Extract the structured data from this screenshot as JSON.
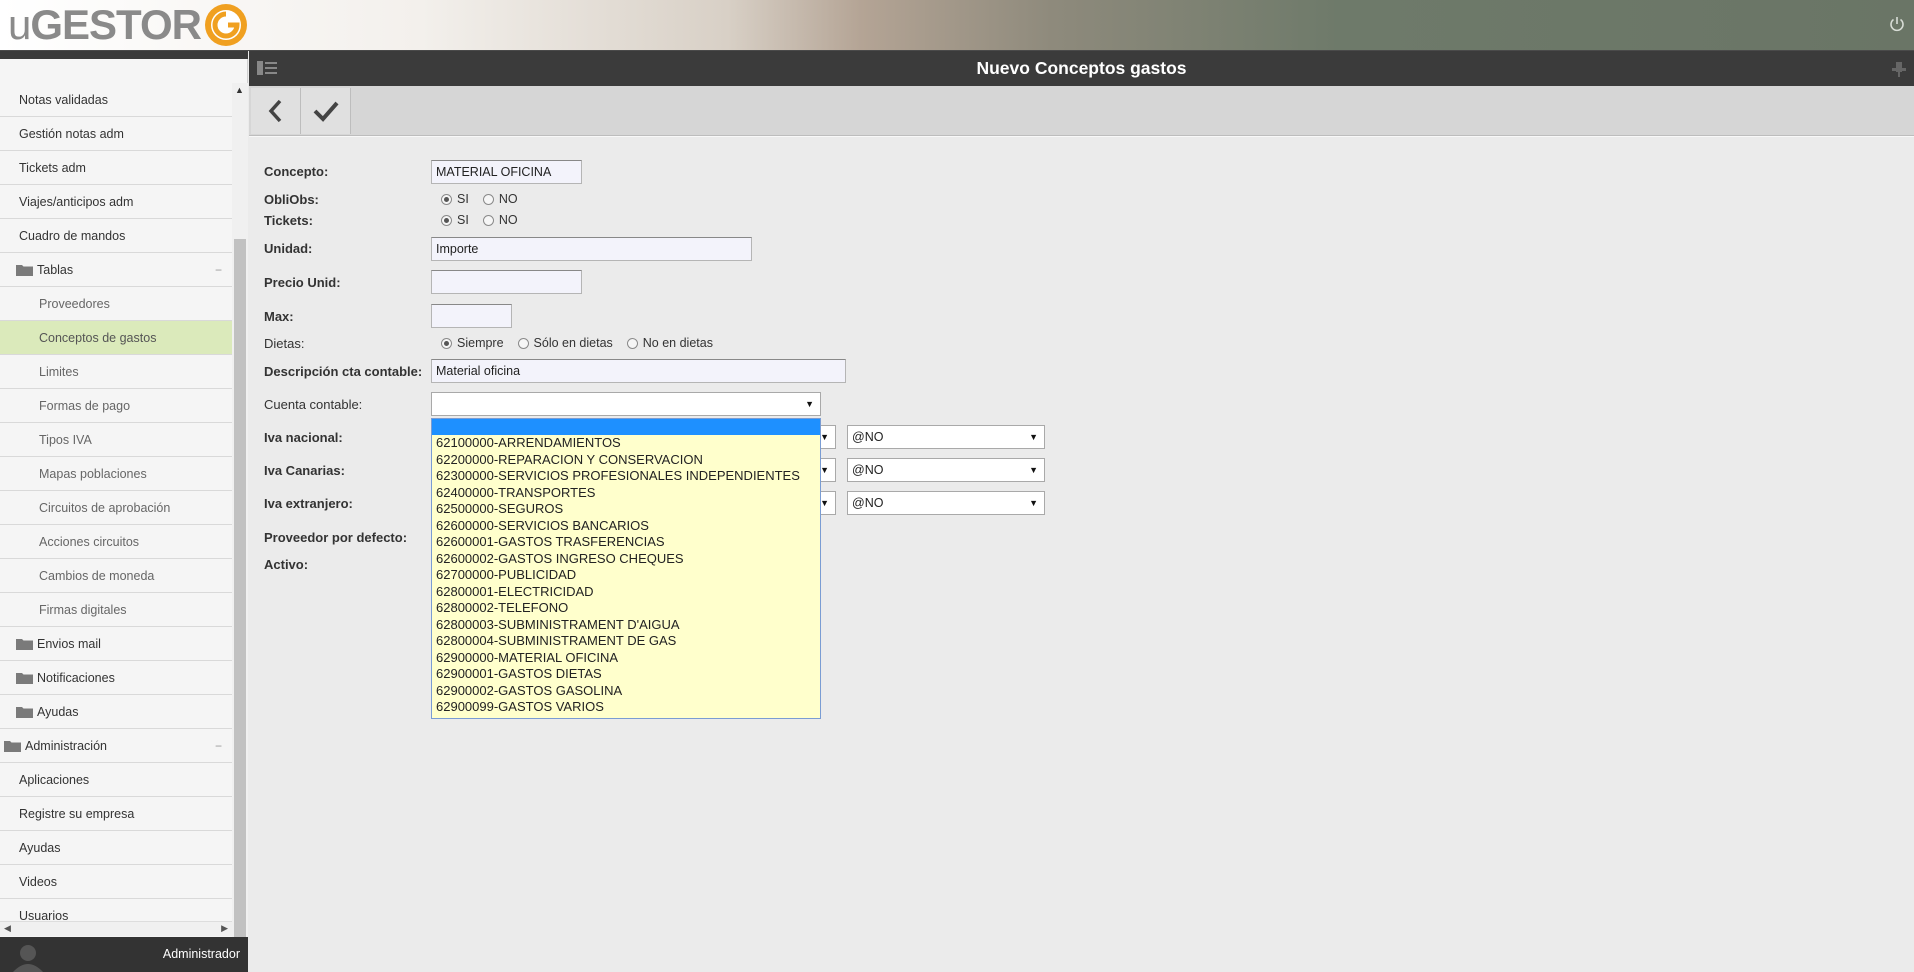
{
  "header": {
    "logo_prefix": "u",
    "logo_name": "GESTOR"
  },
  "main": {
    "title": "Nuevo Conceptos gastos"
  },
  "sidebar": {
    "items": [
      {
        "label": "Notas validadas"
      },
      {
        "label": "Gestión notas adm"
      },
      {
        "label": "Tickets adm"
      },
      {
        "label": "Viajes/anticipos adm"
      },
      {
        "label": "Cuadro de mandos"
      },
      {
        "label": "Tablas"
      },
      {
        "label": "Proveedores"
      },
      {
        "label": "Conceptos de gastos"
      },
      {
        "label": "Limites"
      },
      {
        "label": "Formas de pago"
      },
      {
        "label": "Tipos IVA"
      },
      {
        "label": "Mapas poblaciones"
      },
      {
        "label": "Circuitos de aprobación"
      },
      {
        "label": "Acciones circuitos"
      },
      {
        "label": "Cambios de moneda"
      },
      {
        "label": "Firmas digitales"
      },
      {
        "label": "Envios mail"
      },
      {
        "label": "Notificaciones"
      },
      {
        "label": "Ayudas"
      },
      {
        "label": "Administración"
      },
      {
        "label": "Aplicaciones"
      },
      {
        "label": "Registre su empresa"
      },
      {
        "label": "Ayudas"
      },
      {
        "label": "Videos"
      },
      {
        "label": "Usuarios"
      }
    ],
    "collapse_symbol": "−",
    "user": "Administrador"
  },
  "form": {
    "concepto": {
      "label": "Concepto:",
      "value": "MATERIAL OFICINA"
    },
    "obliobs": {
      "label": "ObliObs:",
      "options": [
        "SI",
        "NO"
      ]
    },
    "tickets": {
      "label": "Tickets:",
      "options": [
        "SI",
        "NO"
      ]
    },
    "unidad": {
      "label": "Unidad:",
      "value": "Importe"
    },
    "precio_unid": {
      "label": "Precio Unid:",
      "value": ""
    },
    "max": {
      "label": "Max:",
      "value": ""
    },
    "dietas": {
      "label": "Dietas:",
      "options": [
        "Siempre",
        "Sólo en dietas",
        "No en dietas"
      ]
    },
    "descripcion": {
      "label": "Descripción cta contable:",
      "value": "Material oficina"
    },
    "cuenta_contable": {
      "label": "Cuenta contable:",
      "value": ""
    },
    "iva_nacional": {
      "label": "Iva nacional:",
      "value": "@NO"
    },
    "iva_canarias": {
      "label": "Iva Canarias:",
      "value": "@NO"
    },
    "iva_extranjero": {
      "label": "Iva extranjero:",
      "value": "@NO"
    },
    "proveedor": {
      "label": "Proveedor por defecto:"
    },
    "activo": {
      "label": "Activo:"
    }
  },
  "dropdown_options": [
    "62100000-ARRENDAMIENTOS",
    "62200000-REPARACION Y CONSERVACION",
    "62300000-SERVICIOS PROFESIONALES INDEPENDIENTES",
    "62400000-TRANSPORTES",
    "62500000-SEGUROS",
    "62600000-SERVICIOS BANCARIOS",
    "62600001-GASTOS TRASFERENCIAS",
    "62600002-GASTOS INGRESO CHEQUES",
    "62700000-PUBLICIDAD",
    "62800001-ELECTRICIDAD",
    "62800002-TELEFONO",
    "62800003-SUBMINISTRAMENT D'AIGUA",
    "62800004-SUBMINISTRAMENT DE GAS",
    "62900000-MATERIAL OFICINA",
    "62900001-GASTOS DIETAS",
    "62900002-GASTOS GASOLINA",
    "62900099-GASTOS VARIOS"
  ]
}
